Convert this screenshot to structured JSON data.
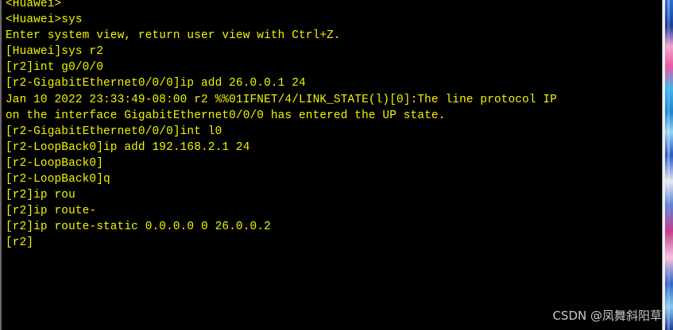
{
  "terminal": {
    "text_color": "#f4f400",
    "background": "#000000",
    "lines": [
      "<Huawei>",
      "<Huawei>sys",
      "Enter system view, return user view with Ctrl+Z.",
      "[Huawei]sys r2",
      "[r2]int g0/0/0",
      "[r2-GigabitEthernet0/0/0]ip add 26.0.0.1 24",
      "Jan 10 2022 23:33:49-08:00 r2 %%01IFNET/4/LINK_STATE(l)[0]:The line protocol IP",
      "on the interface GigabitEthernet0/0/0 has entered the UP state.",
      "[r2-GigabitEthernet0/0/0]int l0",
      "[r2-LoopBack0]ip add 192.168.2.1 24",
      "[r2-LoopBack0]",
      "[r2-LoopBack0]q",
      "[r2]ip rou",
      "[r2]ip route-",
      "[r2]ip route-static 0.0.0.0 0 26.0.0.2",
      "[r2]"
    ]
  },
  "watermark": {
    "text": "CSDN @凤舞斜阳草"
  }
}
